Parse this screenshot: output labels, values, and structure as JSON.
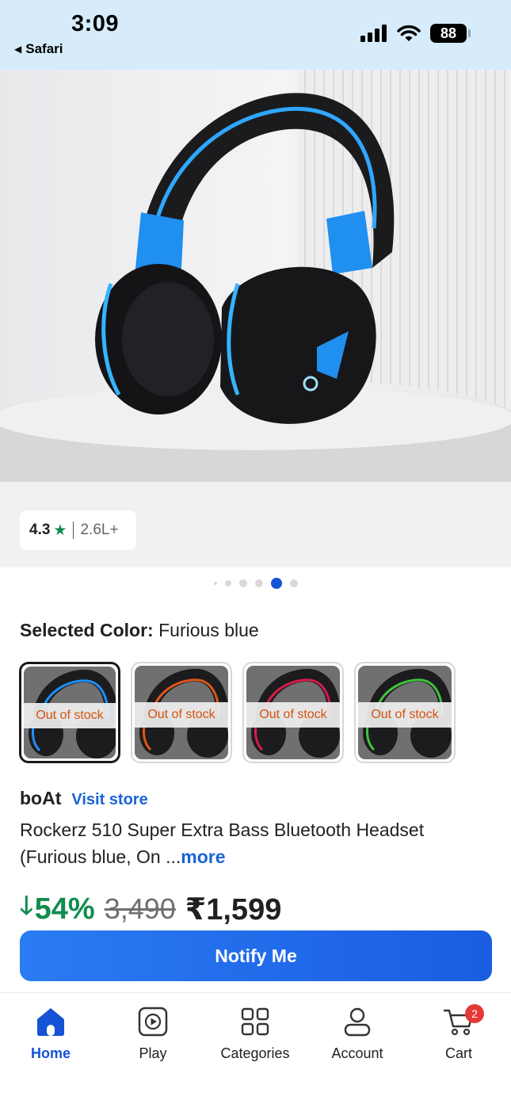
{
  "status_bar": {
    "time": "3:09",
    "back_app": "Safari",
    "battery": "88",
    "icons": [
      "cellular-signal-icon",
      "wifi-icon",
      "battery-icon"
    ]
  },
  "product_image": {
    "rating_value": "4.3",
    "rating_icon": "star-icon",
    "rating_count": "2.6L+",
    "carousel_dots": 6,
    "active_dot_index": 4
  },
  "color_selection": {
    "label": "Selected Color:",
    "value": "Furious blue",
    "swatches": [
      {
        "accent": "#1e90ff",
        "status": "Out of stock"
      },
      {
        "accent": "#e0561a",
        "status": "Out of stock"
      },
      {
        "accent": "#d81b4a",
        "status": "Out of stock"
      },
      {
        "accent": "#3fc43a",
        "status": "Out of stock"
      }
    ]
  },
  "product": {
    "brand": "boAt",
    "visit_store": "Visit store",
    "title": "Rockerz 510 Super Extra Bass Bluetooth Headset (Furious blue, On ...",
    "more": "more",
    "discount": "54%",
    "mrp": "3,490",
    "price": "₹1,599"
  },
  "actions": {
    "notify": "Notify Me"
  },
  "bottom_nav": {
    "items": [
      {
        "label": "Home",
        "icon": "home-icon"
      },
      {
        "label": "Play",
        "icon": "play-icon"
      },
      {
        "label": "Categories",
        "icon": "categories-icon"
      },
      {
        "label": "Account",
        "icon": "account-icon"
      },
      {
        "label": "Cart",
        "icon": "cart-icon"
      }
    ],
    "cart_badge": "2"
  },
  "colors": {
    "accent_blue": "#1553d6",
    "discount_green": "#118c4f",
    "out_of_stock": "#d3530e",
    "badge_red": "#e53935"
  }
}
